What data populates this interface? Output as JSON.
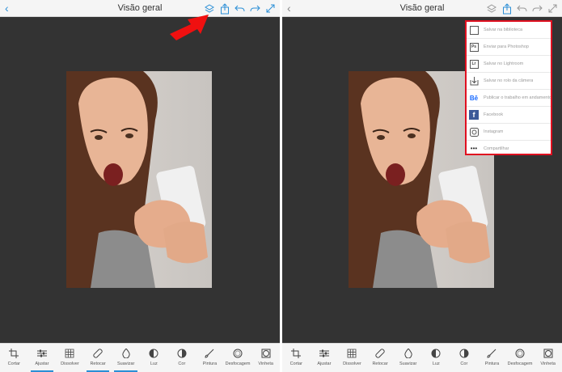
{
  "screens": [
    {
      "title": "Visão geral",
      "top_icons": [
        "back-chevron-icon",
        "layers-icon",
        "share-icon",
        "undo-icon",
        "redo-icon",
        "fullscreen-icon"
      ]
    },
    {
      "title": "Visão geral",
      "top_icons": [
        "back-chevron-icon",
        "layers-icon",
        "share-icon",
        "undo-icon",
        "redo-icon",
        "fullscreen-icon"
      ]
    }
  ],
  "toolbar": {
    "tools": [
      {
        "label": "Cortar",
        "icon": "crop-icon"
      },
      {
        "label": "Ajustar",
        "icon": "sliders-icon"
      },
      {
        "label": "Dissolver",
        "icon": "grid-icon"
      },
      {
        "label": "Retocar",
        "icon": "bandage-icon"
      },
      {
        "label": "Suavizar",
        "icon": "droplet-icon"
      },
      {
        "label": "Luz",
        "icon": "half-circle-icon"
      },
      {
        "label": "Cor",
        "icon": "color-circle-icon"
      },
      {
        "label": "Pintura",
        "icon": "brush-icon"
      },
      {
        "label": "Desfocagem",
        "icon": "blur-circle-icon"
      },
      {
        "label": "Vinheta",
        "icon": "vignette-icon"
      }
    ],
    "active_left": [
      "Ajustar",
      "Retocar",
      "Suavizar"
    ]
  },
  "share_menu": {
    "items": [
      {
        "label": "Salvar na biblioteca",
        "icon": "library-icon"
      },
      {
        "label": "Enviar para Photoshop",
        "icon": "photoshop-icon",
        "badge": "Ps"
      },
      {
        "label": "Salvar no Lightroom",
        "icon": "lightroom-icon",
        "badge": "Lr"
      },
      {
        "label": "Salvar no rolo da câmera",
        "icon": "download-icon"
      },
      {
        "label": "Publicar o trabalho em andamento",
        "icon": "behance-icon",
        "badge": "Bē"
      },
      {
        "label": "Facebook",
        "icon": "facebook-icon",
        "badge": "f"
      },
      {
        "label": "Instagram",
        "icon": "instagram-icon"
      },
      {
        "label": "Compartilhar",
        "icon": "more-dots-icon",
        "badge": "•••"
      }
    ]
  },
  "colors": {
    "accent": "#2b8fd6",
    "canvas": "#333333",
    "highlight": "#e01020",
    "bar": "#f5f5f5"
  }
}
